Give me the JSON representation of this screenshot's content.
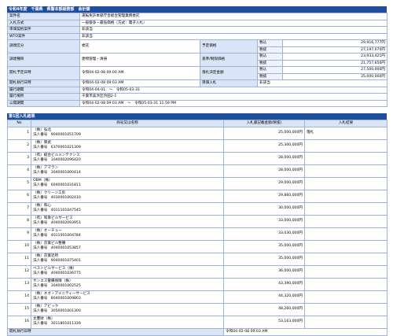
{
  "info": {
    "title": "令和4年度　千葉県　県警本部総務部　会計課",
    "rows": {
      "project_name_label": "案件名",
      "project_name": "運転免許本部庁舎総合管理業務委託",
      "method_label": "入札方式",
      "method": "一般競争・最低価格（方式：電子入札）",
      "joint_label": "単価契約案件",
      "joint": "非該当",
      "wto_label": "WTO案件",
      "wto": "非該当",
      "category_label": "調達区分",
      "category": "委託",
      "type_label": "調達種目",
      "type": "建物管理・清掃",
      "open_label": "開札予定日時",
      "open": "令和04-02-08 09:00 AM",
      "exec_label": "開札執行日時",
      "exec": "令和04-02-08 09:03 AM",
      "period_label": "履行期間",
      "period": "令和04-04-01　～　令和05-03-31",
      "place_label": "履行場所",
      "place": "千葉市美浜区浜田2-1",
      "publish_label": "公開期間",
      "publish": "令和04-02-08 09:03 AM　～　令和05-03-31 11:59 PM",
      "planned_price_label": "予定価格",
      "base_price_label": "基準/制限価格",
      "decided_label": "落札決定金額",
      "unit_label": "単価入札",
      "unit": "非該当",
      "tax_in": "税込",
      "tax_ex": "税抜",
      "planned_in": "29,916,777円",
      "planned_ex": "27,197,070円",
      "base_in": "23,933,421円",
      "base_ex": "21,757,656円",
      "decided_in": "27,500,000円",
      "decided_ex": "25,000,000円"
    }
  },
  "bids": {
    "title": "第1回入札結果",
    "col_no": "No",
    "col_name": "商号又は名称",
    "col_amount": "入札書記載金額(税抜)",
    "col_result": "入札結果",
    "corp_label": "法人番号",
    "rows": [
      {
        "no": "1",
        "name": "（株）弘北",
        "corp": "9040001051709",
        "amount": "25,000,000円",
        "result": "落札"
      },
      {
        "no": "2",
        "name": "（株）東武",
        "corp": "6370001021309",
        "amount": "25,300,000円",
        "result": ""
      },
      {
        "no": "3",
        "name": "（有）総合ビルメンテナンス",
        "corp": "1040002096420",
        "amount": "28,000,000円",
        "result": ""
      },
      {
        "no": "4",
        "name": "（株）アマラン",
        "corp": "3040001000414",
        "amount": "28,000,000円",
        "result": ""
      },
      {
        "no": "5",
        "name": "OBM（株）",
        "corp": "6040001031811",
        "amount": "29,000,000円",
        "result": ""
      },
      {
        "no": "6",
        "name": "（株）クリーン工房",
        "corp": "4030001002410",
        "amount": "29,860,000円",
        "result": ""
      },
      {
        "no": "7",
        "name": "（株）和心",
        "corp": "4011101047545",
        "amount": "30,000,000円",
        "result": ""
      },
      {
        "no": "8",
        "name": "（有）和幸ビルサービス",
        "corp": "4040002093951",
        "amount": "33,000,000円",
        "result": ""
      },
      {
        "no": "9",
        "name": "（株）オーチュー",
        "corp": "4011001004784",
        "amount": "33,030,000円",
        "result": ""
      },
      {
        "no": "10",
        "name": "（株）京葉ビル整備",
        "corp": "4040001053857",
        "amount": "35,000,000円",
        "result": ""
      },
      {
        "no": "11",
        "name": "（株）京葉近所",
        "corp": "9040001075401",
        "amount": "35,000,000円",
        "result": ""
      },
      {
        "no": "12",
        "name": "ベストビルサービス（株）",
        "corp": "4040001036775",
        "amount": "36,000,000円",
        "result": ""
      },
      {
        "no": "13",
        "name": "サンエス警備保障（株）",
        "corp": "3040001002525",
        "amount": "43,390,000円",
        "result": ""
      },
      {
        "no": "14",
        "name": "（株）ネオ・アメニティーサービス",
        "corp": "8040001009803",
        "amount": "44,320,000円",
        "result": ""
      },
      {
        "no": "15",
        "name": "（株）アビック",
        "corp": "3050001001300",
        "amount": "48,260,000円",
        "result": ""
      },
      {
        "no": "16",
        "name": "太豐財（株）",
        "corp": "3011801011339",
        "amount": "53,163,000円",
        "result": ""
      }
    ],
    "exec_label": "開札執行日時",
    "exec": "令和04-02-08 09:03 AM"
  }
}
